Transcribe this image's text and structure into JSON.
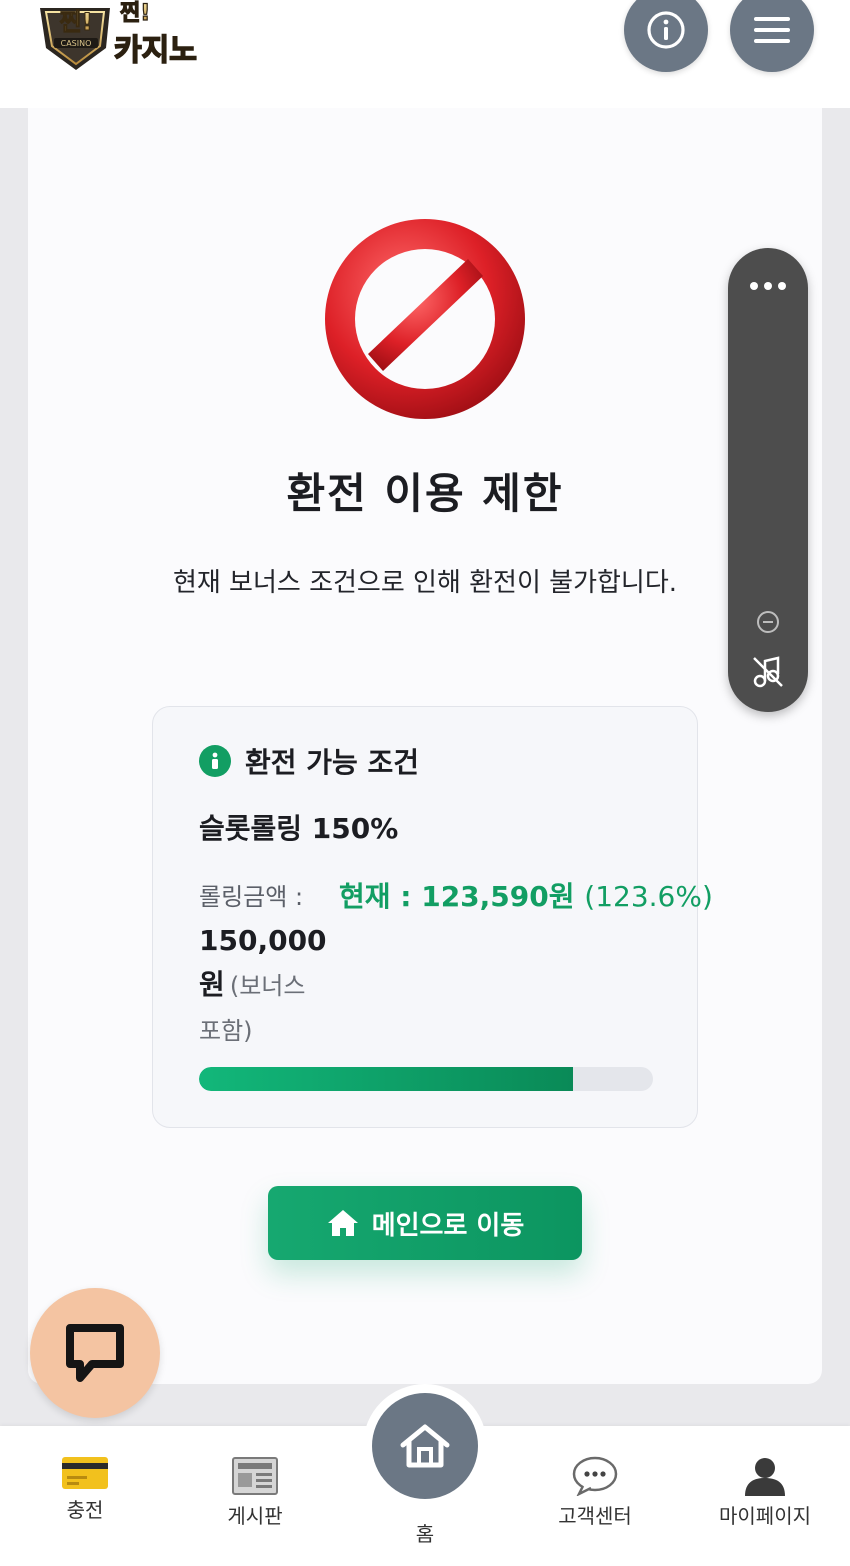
{
  "header": {
    "logo_text_top": "찐!",
    "logo_text_main": "카지노",
    "logo_badge": "CASINO",
    "info_icon": "info-icon",
    "menu_icon": "hamburger-menu-icon"
  },
  "main": {
    "icon": "prohibited-icon",
    "title": "환전 이용 제한",
    "description": "현재 보너스 조건으로 인해 환전이 불가합니다.",
    "condition": {
      "heading": "환전 가능 조건",
      "rule": "슬롯롤링 150%",
      "rolling_label": "롤링금액 :",
      "rolling_amount": "150,000",
      "rolling_unit": "원",
      "bonus_note_1": "(보너스",
      "bonus_note_2": "포함)",
      "current_text": "현재 : 123,590원",
      "current_percent": "(123.6%)",
      "progress_percent": 82.4
    },
    "button_label": "메인으로 이동"
  },
  "bottom_nav": {
    "charge": "충전",
    "board": "게시판",
    "home": "홈",
    "support": "고객센터",
    "mypage": "마이페이지"
  },
  "colors": {
    "accent_green": "#129e63",
    "nav_gray": "#6b7785",
    "chat_peach": "#f4c4a2",
    "stop_red": "#d9252b"
  }
}
